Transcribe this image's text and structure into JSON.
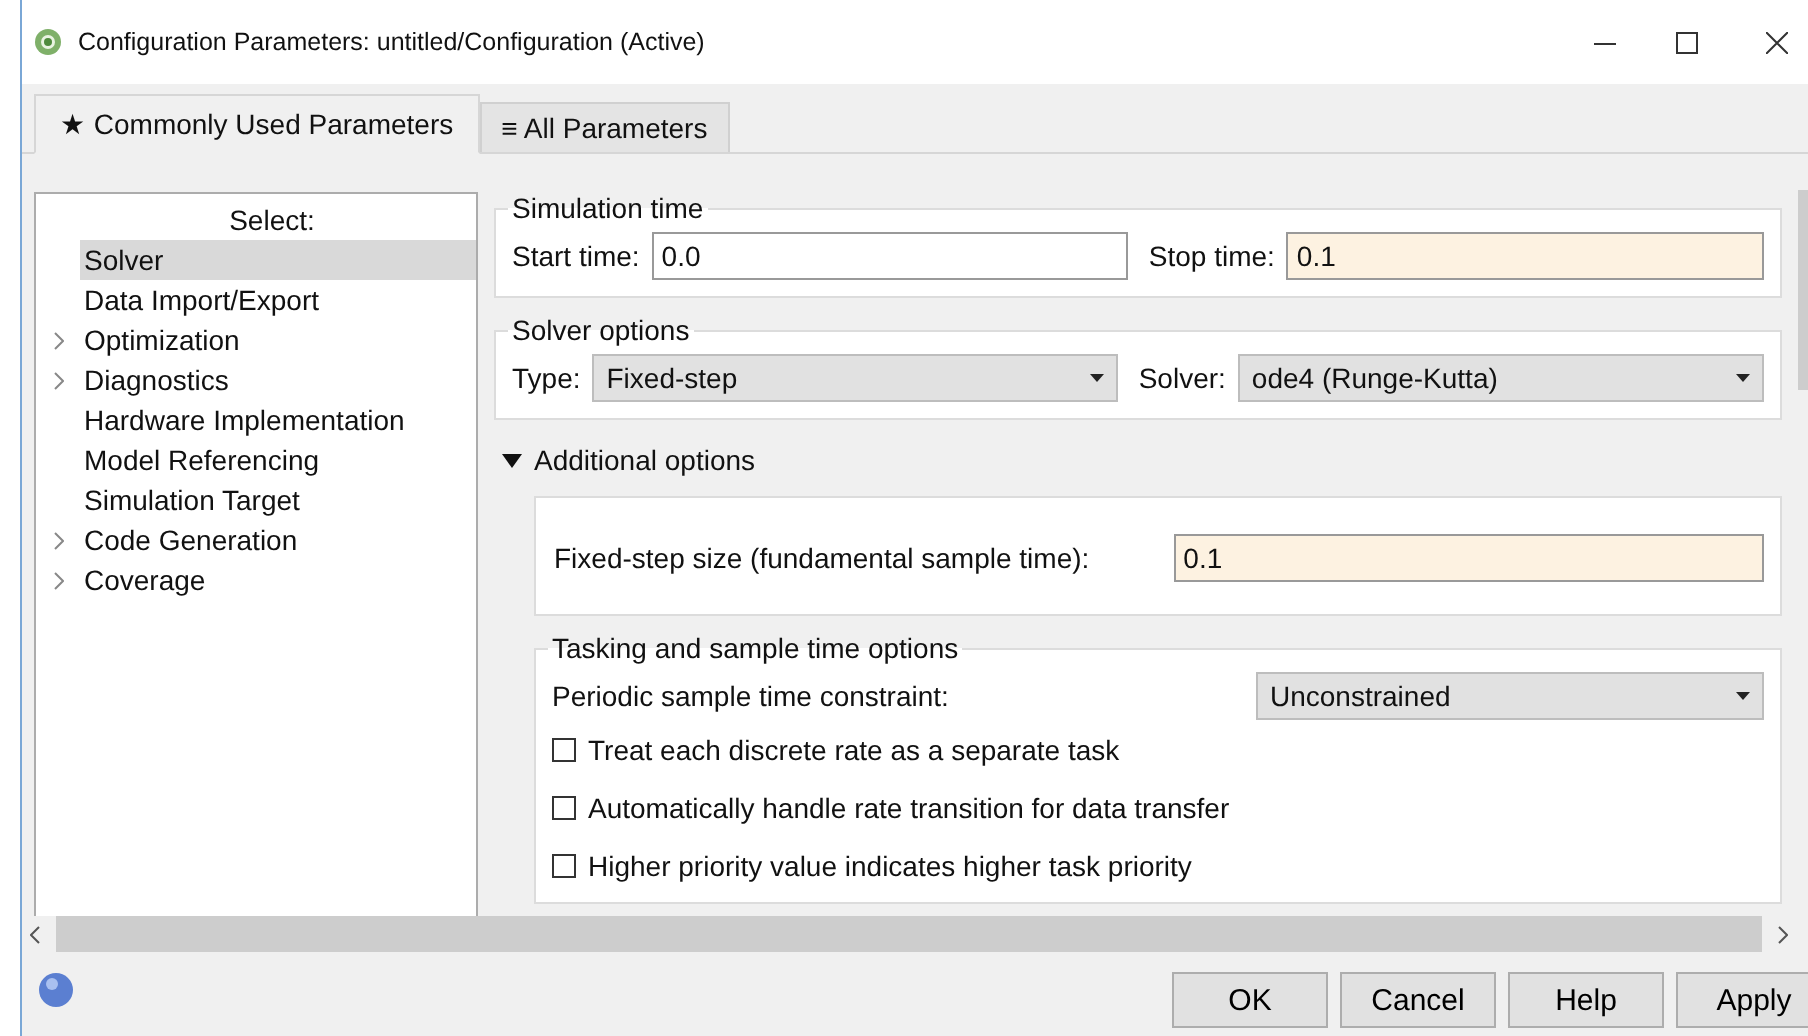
{
  "window": {
    "title": "Configuration Parameters: untitled/Configuration (Active)"
  },
  "tabs": [
    {
      "label": "★ Commonly Used Parameters",
      "selected": true
    },
    {
      "label": "≡ All Parameters",
      "selected": false
    }
  ],
  "sidebar": {
    "heading": "Select:",
    "items": [
      {
        "label": "Solver",
        "selected": true,
        "expandable": false
      },
      {
        "label": "Data Import/Export",
        "selected": false,
        "expandable": false
      },
      {
        "label": "Optimization",
        "selected": false,
        "expandable": true
      },
      {
        "label": "Diagnostics",
        "selected": false,
        "expandable": true
      },
      {
        "label": "Hardware Implementation",
        "selected": false,
        "expandable": false
      },
      {
        "label": "Model Referencing",
        "selected": false,
        "expandable": false
      },
      {
        "label": "Simulation Target",
        "selected": false,
        "expandable": false
      },
      {
        "label": "Code Generation",
        "selected": false,
        "expandable": true
      },
      {
        "label": "Coverage",
        "selected": false,
        "expandable": true
      }
    ]
  },
  "simulation_time": {
    "title": "Simulation time",
    "start_label": "Start time:",
    "start_value": "0.0",
    "start_modified": false,
    "stop_label": "Stop time:",
    "stop_value": "0.1",
    "stop_modified": true
  },
  "solver_options": {
    "title": "Solver options",
    "type_label": "Type:",
    "type_value": "Fixed-step",
    "solver_label": "Solver:",
    "solver_value": "ode4 (Runge-Kutta)"
  },
  "additional_options": {
    "label": "Additional options",
    "expanded": true,
    "step_size": {
      "label": "Fixed-step size (fundamental sample time):",
      "value": "0.1",
      "modified": true
    },
    "tasking": {
      "title": "Tasking and sample time options",
      "constraint_label": "Periodic sample time constraint:",
      "constraint_value": "Unconstrained",
      "checkboxes": [
        {
          "label": "Treat each discrete rate as a separate task",
          "checked": false
        },
        {
          "label": "Automatically handle rate transition for data transfer",
          "checked": false
        },
        {
          "label": "Higher priority value indicates higher task priority",
          "checked": false
        }
      ]
    }
  },
  "buttons": [
    "OK",
    "Cancel",
    "Help",
    "Apply"
  ]
}
